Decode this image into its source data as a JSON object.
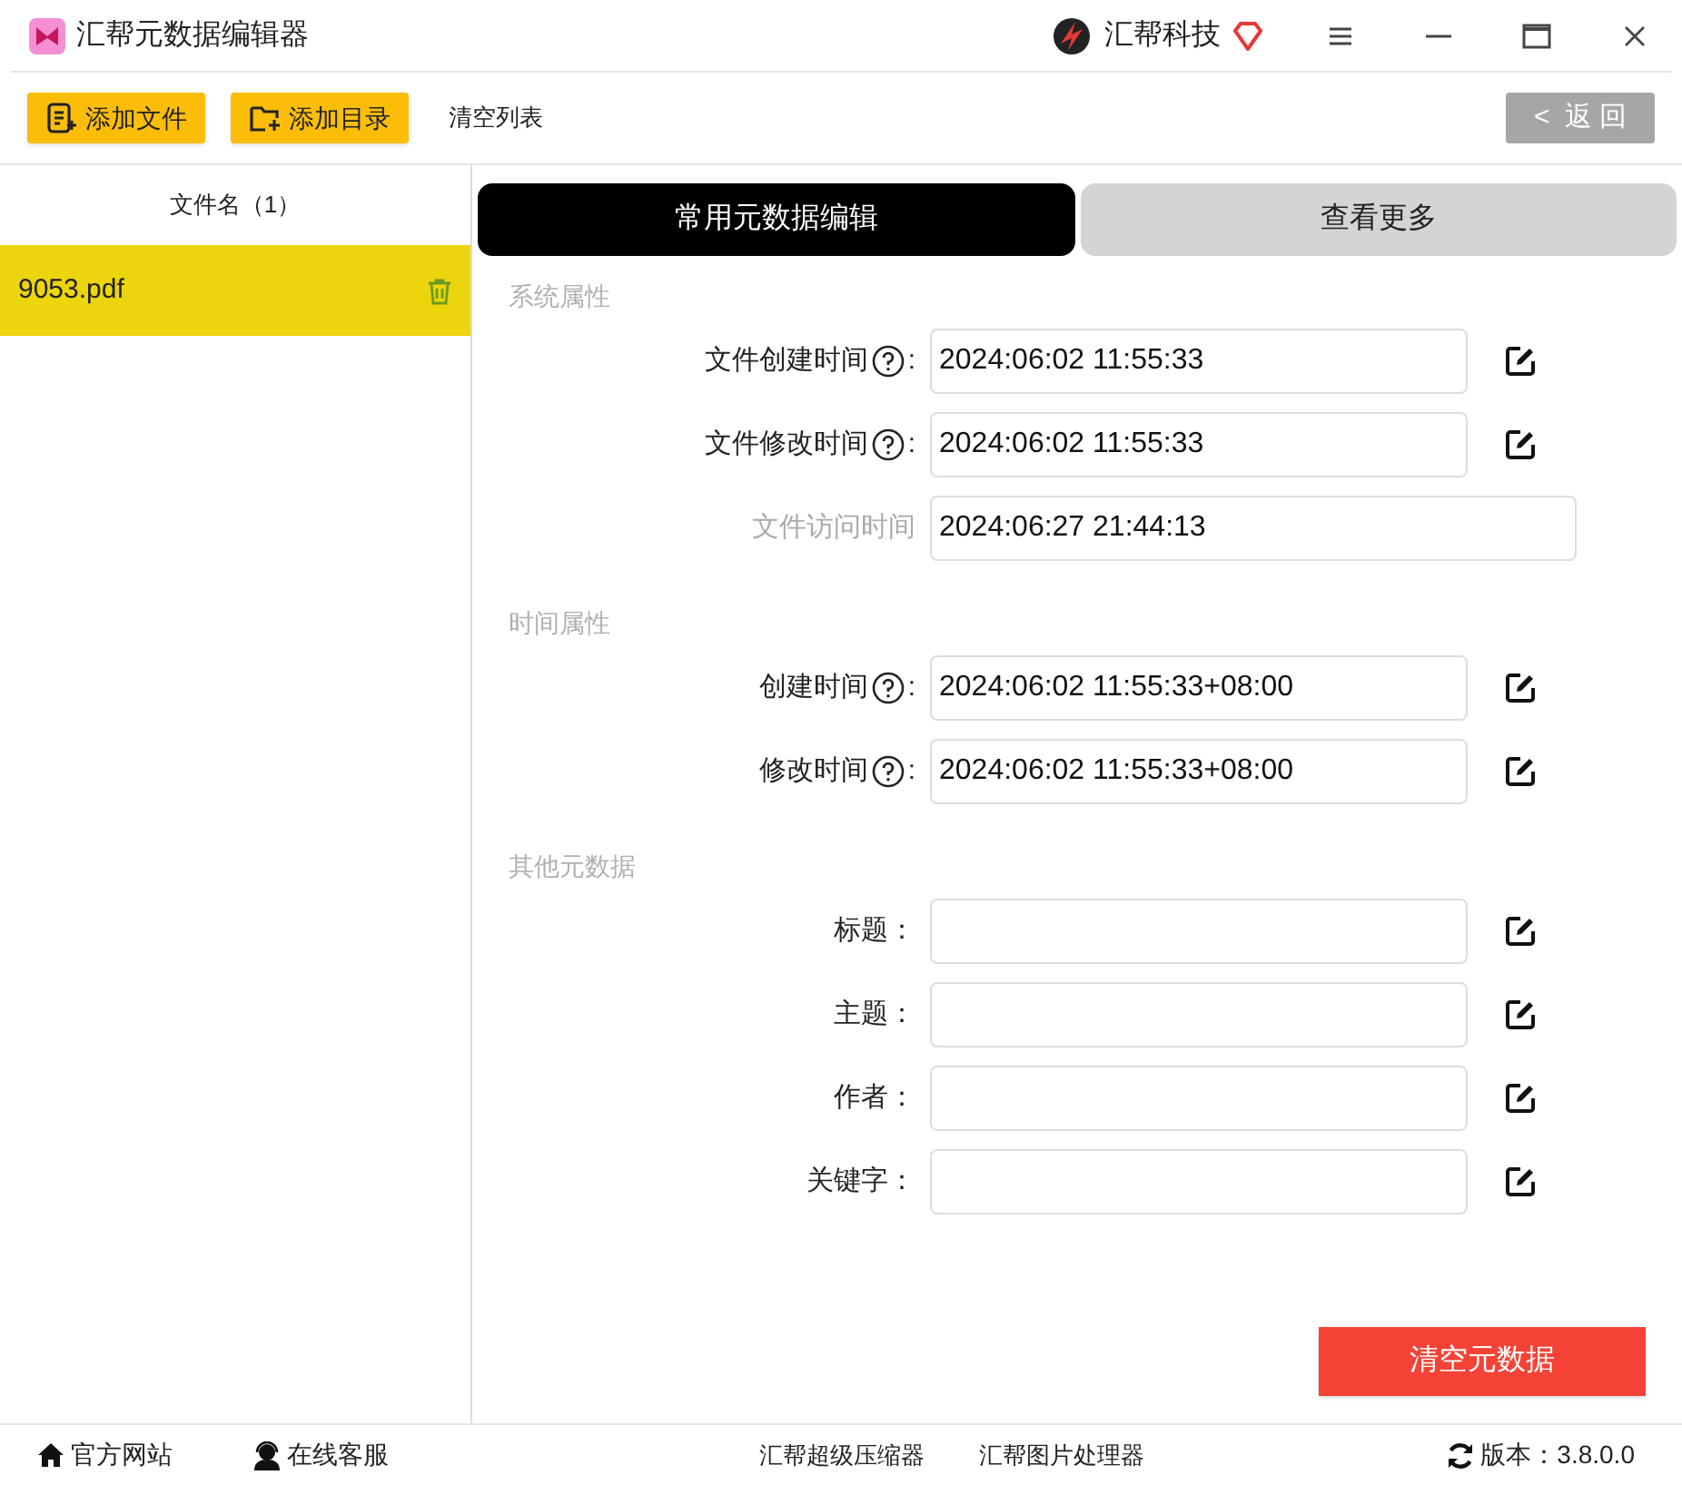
{
  "window": {
    "title": "汇帮元数据编辑器",
    "brand": "汇帮科技"
  },
  "toolbar": {
    "buttons": [
      {
        "label": "添加文件",
        "kind": "file"
      },
      {
        "label": "添加目录",
        "kind": "folder"
      },
      {
        "label": "清空列表",
        "kind": "text"
      }
    ],
    "back": {
      "icon": "<",
      "label": "返 回"
    }
  },
  "file_list": {
    "header": "文件名（1）",
    "items": [
      {
        "name": "9053.pdf",
        "selected": true
      }
    ]
  },
  "tabs": [
    {
      "label": "常用元数据编辑",
      "selected": true
    },
    {
      "label": "查看更多",
      "selected": false
    }
  ],
  "sections": [
    {
      "title": "系统属性",
      "rows": [
        {
          "label": "文件创建时间",
          "help": true,
          "colon": ":",
          "value": "2024:06:02 11:55:33",
          "disabled": false
        },
        {
          "label": "文件修改时间",
          "help": true,
          "colon": ":",
          "value": "2024:06:02 11:55:33",
          "disabled": false
        },
        {
          "label": "文件访问时间",
          "help": false,
          "value": "2024:06:27 21:44:13",
          "disabled": true
        }
      ]
    },
    {
      "title": "时间属性",
      "rows": [
        {
          "label": "创建时间",
          "help": true,
          "colon": ":",
          "value": "2024:06:02 11:55:33+08:00",
          "disabled": false
        },
        {
          "label": "修改时间",
          "help": true,
          "colon": ":",
          "value": "2024:06:02 11:55:33+08:00",
          "disabled": false
        }
      ]
    },
    {
      "title": "其他元数据",
      "rows": [
        {
          "label": "标题：",
          "help": false,
          "value": "",
          "disabled": false
        },
        {
          "label": "主题：",
          "help": false,
          "value": "",
          "disabled": false
        },
        {
          "label": "作者：",
          "help": false,
          "value": "",
          "disabled": false
        },
        {
          "label": "关键字：",
          "help": false,
          "value": "",
          "disabled": false
        }
      ]
    }
  ],
  "clear_button": "清空元数据",
  "footer": {
    "links": [
      {
        "label": "官方网站",
        "kind": "home"
      },
      {
        "label": "在线客服",
        "kind": "support"
      }
    ],
    "apps": [
      "汇帮超级压缩器",
      "汇帮图片处理器"
    ],
    "version": "版本：3.8.0.0"
  }
}
